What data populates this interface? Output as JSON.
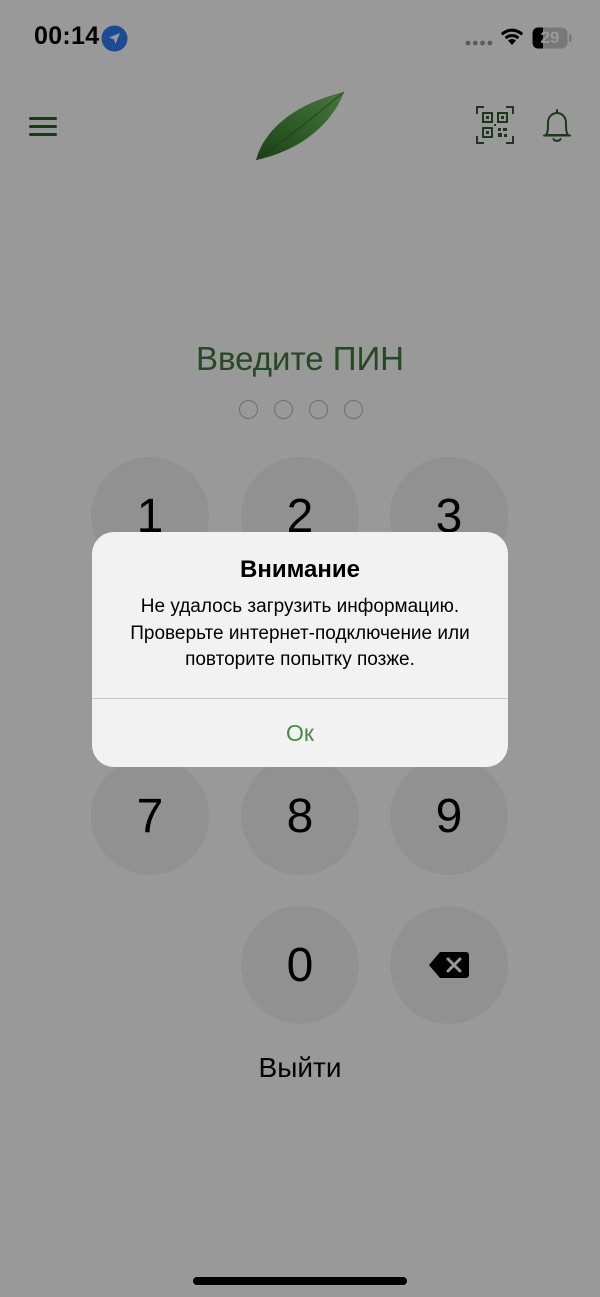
{
  "status_bar": {
    "time": "00:14",
    "battery": "29"
  },
  "header": {
    "icons": [
      "menu-icon",
      "leaf-logo",
      "qr-code-icon",
      "bell-icon"
    ]
  },
  "pin": {
    "title": "Введите ПИН",
    "dots_total": 4,
    "dots_filled": 0
  },
  "keypad": {
    "keys": [
      "1",
      "2",
      "3",
      "7",
      "8",
      "9",
      "0"
    ],
    "delete_icon": "backspace-icon"
  },
  "logout_label": "Выйти",
  "alert": {
    "title": "Внимание",
    "message": "Не удалось загрузить информацию. Проверьте интернет-подключение или повторите попытку позже.",
    "ok_label": "Ок"
  },
  "colors": {
    "brand_green": "#3f7a3b",
    "ok_green": "#4c8a48",
    "location_blue": "#2f7cf6"
  }
}
